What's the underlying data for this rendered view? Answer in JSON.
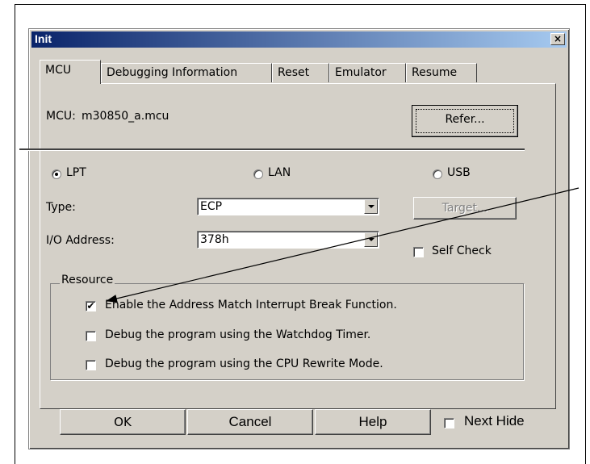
{
  "dialog": {
    "title": "Init",
    "close_glyph": "×"
  },
  "tabs": [
    "MCU",
    "Debugging Information",
    "Reset",
    "Emulator",
    "Resume"
  ],
  "mcu": {
    "label": "MCU:",
    "value": "m30850_a.mcu",
    "refer_label": "Refer..."
  },
  "connection": {
    "options": [
      "LPT",
      "LAN",
      "USB"
    ],
    "selected": "LPT",
    "target_label": "Target...",
    "self_check_label": "Self Check",
    "self_check_checked": false
  },
  "type": {
    "label": "Type:",
    "value": "ECP"
  },
  "io_address": {
    "label": "I/O Address:",
    "value": "378h"
  },
  "resource": {
    "title": "Resource",
    "items": [
      {
        "label": "Enable the Address Match Interrupt Break Function.",
        "checked": true
      },
      {
        "label": "Debug the program using the Watchdog Timer.",
        "checked": false
      },
      {
        "label": "Debug the program using the CPU Rewrite Mode.",
        "checked": false
      }
    ]
  },
  "buttons": {
    "ok": "OK",
    "cancel": "Cancel",
    "help": "Help",
    "next_hide": "Next Hide",
    "next_hide_checked": false
  },
  "check_glyph": "✔"
}
